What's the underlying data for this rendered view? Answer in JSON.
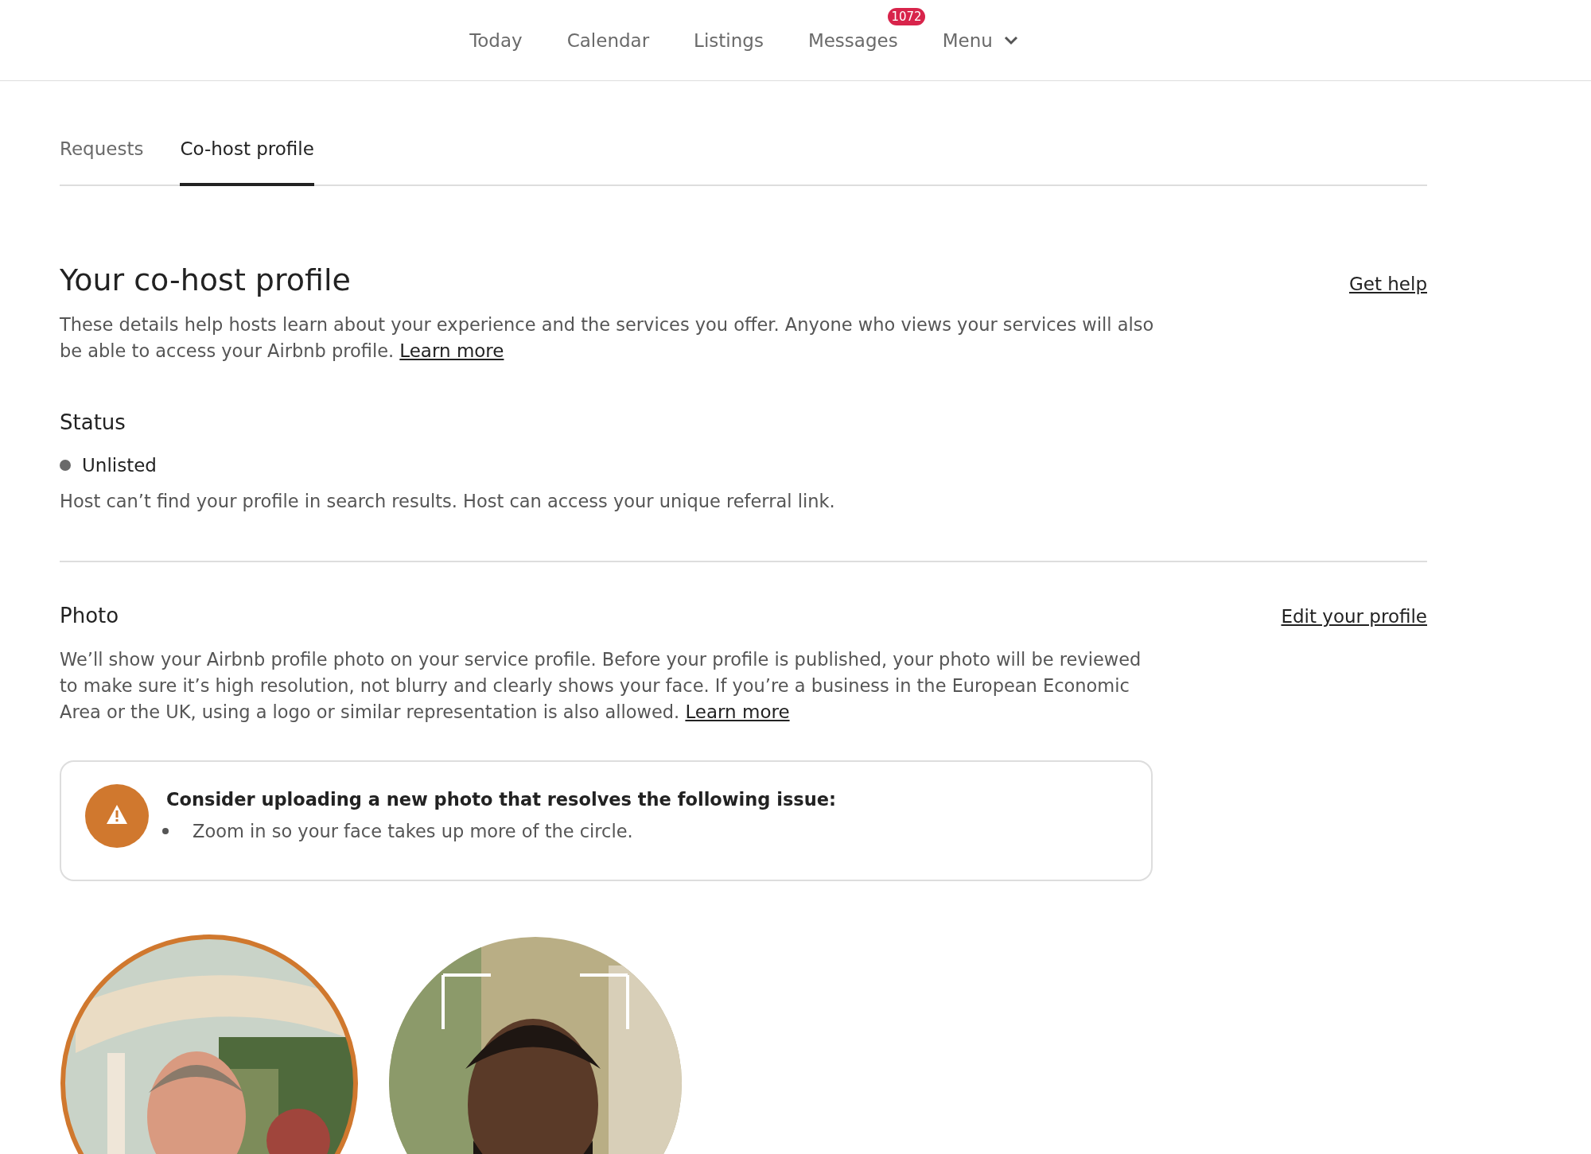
{
  "nav": {
    "items": [
      {
        "label": "Today",
        "selected": false
      },
      {
        "label": "Calendar",
        "selected": false
      },
      {
        "label": "Listings",
        "selected": false
      },
      {
        "label": "Messages",
        "selected": false,
        "badge": "1072"
      },
      {
        "label": "Menu",
        "selected": false,
        "dropdown": true
      }
    ]
  },
  "tabs": [
    {
      "label": "Requests",
      "selected": false
    },
    {
      "label": "Co-host profile",
      "selected": true
    }
  ],
  "header": {
    "title": "Your co-host profile",
    "help_link": "Get help",
    "description": "These details help hosts learn about your experience and the services you offer. Anyone who views your services will also be able to access your Airbnb profile.",
    "learn_more": "Learn more"
  },
  "status": {
    "title": "Status",
    "value": "Unlisted",
    "description": "Host can’t find your profile in search results. Host can access your unique referral link."
  },
  "photo": {
    "title": "Photo",
    "edit_link": "Edit your profile",
    "description": "We’ll show your Airbnb profile photo on your service profile. Before your profile is published, your photo will be reviewed to make sure it’s high resolution, not blurry and clearly shows your face. If you’re a business in the European Economic Area or the UK, using a logo or similar representation is also allowed.",
    "learn_more": "Learn more",
    "notice": {
      "title": "Consider uploading a new photo that resolves the following issue:",
      "issues": [
        "Zoom in so your face takes up more of the circle."
      ]
    },
    "examples": [
      {
        "flagged": true
      },
      {
        "flagged": false
      }
    ]
  }
}
